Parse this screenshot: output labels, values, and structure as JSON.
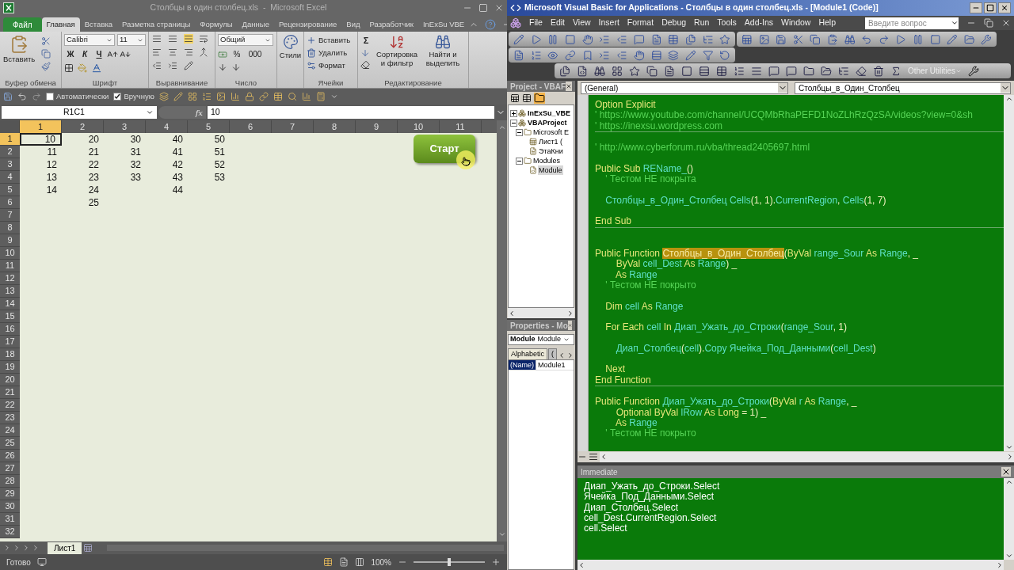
{
  "excel": {
    "title": "Столбцы в один столбец.xls  -  Microsoft Excel",
    "file_button": "Файл",
    "tabs": [
      {
        "label": "Главная",
        "selected": true
      },
      {
        "label": "Вставка",
        "selected": false
      },
      {
        "label": "Разметка страницы",
        "selected": false
      },
      {
        "label": "Формулы",
        "selected": false
      },
      {
        "label": "Данные",
        "selected": false
      },
      {
        "label": "Рецензирование",
        "selected": false
      },
      {
        "label": "Вид",
        "selected": false
      },
      {
        "label": "Разработчик",
        "selected": false
      },
      {
        "label": "InExSu VBE",
        "selected": false
      }
    ],
    "ribbon": {
      "clipboard": {
        "paste": "Вставить",
        "label": "Буфер обмена"
      },
      "font": {
        "name": "Calibri",
        "size": "11",
        "bold": "Ж",
        "italic": "К",
        "underline": "Ч",
        "label": "Шрифт"
      },
      "alignment": {
        "label": "Выравнивание"
      },
      "number": {
        "format": "Общий",
        "percent": "%",
        "thousands": "000",
        "label": "Число"
      },
      "styles": {
        "button": "Стили"
      },
      "cells": {
        "insert": "Вставить",
        "delete": "Удалить",
        "format": "Формат",
        "label": "Ячейки"
      },
      "editing": {
        "sum": "Σ",
        "sort": "Сортировка и фильтр",
        "find": "Найти и выделить",
        "label": "Редактирование"
      }
    },
    "calc_modes": [
      {
        "label": "Автоматически",
        "checked": false
      },
      {
        "label": "Вручную",
        "checked": true
      }
    ],
    "name_box": "R1C1",
    "function_label": "fx",
    "formula": "10",
    "columns": [
      {
        "label": "1",
        "selected": true
      },
      {
        "label": "2",
        "selected": false
      },
      {
        "label": "3",
        "selected": false
      },
      {
        "label": "4",
        "selected": false
      },
      {
        "label": "5",
        "selected": false
      },
      {
        "label": "6",
        "selected": false
      },
      {
        "label": "7",
        "selected": false
      },
      {
        "label": "8",
        "selected": false
      },
      {
        "label": "9",
        "selected": false
      },
      {
        "label": "10",
        "selected": false
      },
      {
        "label": "11",
        "selected": false
      }
    ],
    "rows": [
      {
        "label": "1",
        "selected": true,
        "cells": [
          "10",
          "20",
          "30",
          "40",
          "50"
        ]
      },
      {
        "label": "2",
        "selected": false,
        "cells": [
          "11",
          "21",
          "31",
          "41",
          "51"
        ]
      },
      {
        "label": "3",
        "selected": false,
        "cells": [
          "12",
          "22",
          "32",
          "42",
          "52"
        ]
      },
      {
        "label": "4",
        "selected": false,
        "cells": [
          "13",
          "23",
          "33",
          "43",
          "53"
        ]
      },
      {
        "label": "5",
        "selected": false,
        "cells": [
          "14",
          "24",
          null,
          "44"
        ]
      },
      {
        "label": "6",
        "selected": false,
        "cells": [
          null,
          "25"
        ]
      },
      {
        "label": "7",
        "selected": false
      },
      {
        "label": "8",
        "selected": false
      },
      {
        "label": "9",
        "selected": false
      },
      {
        "label": "10",
        "selected": false
      },
      {
        "label": "11",
        "selected": false
      },
      {
        "label": "12",
        "selected": false
      },
      {
        "label": "13",
        "selected": false
      },
      {
        "label": "14",
        "selected": false
      },
      {
        "label": "15",
        "selected": false
      },
      {
        "label": "16",
        "selected": false
      },
      {
        "label": "17",
        "selected": false
      },
      {
        "label": "18",
        "selected": false
      },
      {
        "label": "19",
        "selected": false
      },
      {
        "label": "20",
        "selected": false
      },
      {
        "label": "21",
        "selected": false
      },
      {
        "label": "22",
        "selected": false
      },
      {
        "label": "23",
        "selected": false
      },
      {
        "label": "24",
        "selected": false
      },
      {
        "label": "25",
        "selected": false
      },
      {
        "label": "26",
        "selected": false
      },
      {
        "label": "27",
        "selected": false
      },
      {
        "label": "28",
        "selected": false
      },
      {
        "label": "29",
        "selected": false
      },
      {
        "label": "30",
        "selected": false
      },
      {
        "label": "31",
        "selected": false
      },
      {
        "label": "32",
        "selected": false
      }
    ],
    "start_button": "Старт",
    "sheet_tabs": [
      {
        "label": "Лист1",
        "selected": true
      }
    ],
    "status_bar": {
      "status": "Готово",
      "zoom": {
        "label": "100%",
        "level": 0.5
      }
    }
  },
  "vba": {
    "title": "Microsoft Visual Basic for Applications - Столбцы в один столбец.xls - [Module1 (Code)]",
    "menus": [
      "File",
      "Edit",
      "View",
      "Insert",
      "Format",
      "Debug",
      "Run",
      "Tools",
      "Add-Ins",
      "Window",
      "Help"
    ],
    "search_placeholder": "Введите вопрос",
    "toolbar_button": "Other Utilities",
    "project": {
      "title": "Project - VBAF",
      "tree": [
        {
          "label": "InExSu_VBE",
          "kind": "project",
          "expanded": false,
          "selected": false
        },
        {
          "label": "VBAProject",
          "kind": "project",
          "expanded": true,
          "selected": false,
          "children": [
            {
              "label": "Microsoft E",
              "kind": "folder",
              "expanded": true,
              "selected": false,
              "children": [
                {
                  "label": "Лист1 (",
                  "kind": "sheet",
                  "selected": false
                },
                {
                  "label": "ЭтаКни",
                  "kind": "workbook",
                  "selected": false
                }
              ]
            },
            {
              "label": "Modules",
              "kind": "folder",
              "expanded": true,
              "selected": false,
              "children": [
                {
                  "label": "Module",
                  "kind": "module",
                  "selected": true
                }
              ]
            }
          ]
        }
      ]
    },
    "properties": {
      "title": "Properties - Mo",
      "object": "Module",
      "object_type": "Module",
      "tabs": [
        {
          "label": "Alphabetic",
          "selected": true
        },
        {
          "label": "(",
          "selected": false
        }
      ],
      "rows": [
        {
          "name": "(Name)",
          "value": "Module1",
          "selected": true
        }
      ]
    },
    "code": {
      "object": "(General)",
      "procedure": "Столбцы_в_Один_Столбец",
      "lines": [
        {
          "kind": "code",
          "tokens": [
            {
              "kind": "keyword",
              "text": "Option Explicit"
            }
          ]
        },
        {
          "kind": "code",
          "tokens": [
            {
              "kind": "comment",
              "text": "' https://www.youtube.com/channel/UCQMbRhaPEFD1NoZLhRzQzSA/videos?view=0&sh"
            }
          ]
        },
        {
          "kind": "code",
          "tokens": [
            {
              "kind": "comment",
              "text": "' https://inexsu.wordpress.com"
            }
          ]
        },
        {
          "kind": "divider"
        },
        {
          "kind": "blank"
        },
        {
          "kind": "code",
          "tokens": [
            {
              "kind": "comment",
              "text": "' http://www.cyberforum.ru/vba/thread2405697.html"
            }
          ]
        },
        {
          "kind": "blank"
        },
        {
          "kind": "code",
          "tokens": [
            {
              "kind": "keyword",
              "text": "Public Sub "
            },
            {
              "kind": "name",
              "text": "REName_"
            },
            {
              "kind": "text",
              "text": "()"
            }
          ]
        },
        {
          "kind": "code",
          "tokens": [
            {
              "kind": "comment",
              "text": "    ' Тестом НЕ покрыта"
            }
          ]
        },
        {
          "kind": "blank"
        },
        {
          "kind": "code",
          "tokens": [
            {
              "kind": "name",
              "text": "    Столбцы_в_Один_Столбец Cells"
            },
            {
              "kind": "text",
              "text": "(1, 1)."
            },
            {
              "kind": "name",
              "text": "CurrentRegion"
            },
            {
              "kind": "text",
              "text": ", "
            },
            {
              "kind": "name",
              "text": "Cells"
            },
            {
              "kind": "text",
              "text": "(1, 7)"
            }
          ]
        },
        {
          "kind": "blank"
        },
        {
          "kind": "code",
          "tokens": [
            {
              "kind": "keyword",
              "text": "End Sub"
            }
          ]
        },
        {
          "kind": "divider"
        },
        {
          "kind": "blank"
        },
        {
          "kind": "blank"
        },
        {
          "kind": "code",
          "tokens": [
            {
              "kind": "keyword",
              "text": "Public Function "
            },
            {
              "kind": "highlight",
              "text": "Столбцы_в_Один_Столбец"
            },
            {
              "kind": "text",
              "text": "("
            },
            {
              "kind": "keyword",
              "text": "ByVal "
            },
            {
              "kind": "name",
              "text": "range_Sour "
            },
            {
              "kind": "keyword",
              "text": "As "
            },
            {
              "kind": "name",
              "text": "Range"
            },
            {
              "kind": "text",
              "text": ", _"
            }
          ]
        },
        {
          "kind": "code",
          "tokens": [
            {
              "kind": "keyword",
              "text": "        ByVal "
            },
            {
              "kind": "name",
              "text": "cell_Dest "
            },
            {
              "kind": "keyword",
              "text": "As "
            },
            {
              "kind": "name",
              "text": "Range"
            },
            {
              "kind": "text",
              "text": ") _"
            }
          ]
        },
        {
          "kind": "code",
          "tokens": [
            {
              "kind": "keyword",
              "text": "        As "
            },
            {
              "kind": "name",
              "text": "Range"
            }
          ]
        },
        {
          "kind": "code",
          "tokens": [
            {
              "kind": "comment",
              "text": "    ' Тестом НЕ покрыто"
            }
          ]
        },
        {
          "kind": "blank"
        },
        {
          "kind": "code",
          "tokens": [
            {
              "kind": "keyword",
              "text": "    Dim "
            },
            {
              "kind": "name",
              "text": "cell "
            },
            {
              "kind": "keyword",
              "text": "As "
            },
            {
              "kind": "name",
              "text": "Range"
            }
          ]
        },
        {
          "kind": "blank"
        },
        {
          "kind": "code",
          "tokens": [
            {
              "kind": "keyword",
              "text": "    For Each "
            },
            {
              "kind": "name",
              "text": "cell "
            },
            {
              "kind": "keyword",
              "text": "In "
            },
            {
              "kind": "name",
              "text": "Диап_Ужать_до_Строки"
            },
            {
              "kind": "text",
              "text": "("
            },
            {
              "kind": "name",
              "text": "range_Sour"
            },
            {
              "kind": "text",
              "text": ", 1)"
            }
          ]
        },
        {
          "kind": "blank"
        },
        {
          "kind": "code",
          "tokens": [
            {
              "kind": "name",
              "text": "        Диап_Столбец"
            },
            {
              "kind": "text",
              "text": "("
            },
            {
              "kind": "name",
              "text": "cell"
            },
            {
              "kind": "text",
              "text": ")."
            },
            {
              "kind": "name",
              "text": "Copy Ячейка_Под_Данными"
            },
            {
              "kind": "text",
              "text": "("
            },
            {
              "kind": "name",
              "text": "cell_Dest"
            },
            {
              "kind": "text",
              "text": ")"
            }
          ]
        },
        {
          "kind": "blank"
        },
        {
          "kind": "code",
          "tokens": [
            {
              "kind": "keyword",
              "text": "    Next"
            }
          ]
        },
        {
          "kind": "code",
          "tokens": [
            {
              "kind": "keyword",
              "text": "End Function"
            }
          ]
        },
        {
          "kind": "divider"
        },
        {
          "kind": "blank"
        },
        {
          "kind": "code",
          "tokens": [
            {
              "kind": "keyword",
              "text": "Public Function "
            },
            {
              "kind": "name",
              "text": "Диап_Ужать_до_Строки"
            },
            {
              "kind": "text",
              "text": "("
            },
            {
              "kind": "keyword",
              "text": "ByVal "
            },
            {
              "kind": "name",
              "text": "r "
            },
            {
              "kind": "keyword",
              "text": "As "
            },
            {
              "kind": "name",
              "text": "Range"
            },
            {
              "kind": "text",
              "text": ", _"
            }
          ]
        },
        {
          "kind": "code",
          "tokens": [
            {
              "kind": "keyword",
              "text": "        Optional ByVal "
            },
            {
              "kind": "name",
              "text": "lRow "
            },
            {
              "kind": "keyword",
              "text": "As Long "
            },
            {
              "kind": "text",
              "text": "= 1) _"
            }
          ]
        },
        {
          "kind": "code",
          "tokens": [
            {
              "kind": "keyword",
              "text": "        As "
            },
            {
              "kind": "name",
              "text": "Range"
            }
          ]
        },
        {
          "kind": "code",
          "tokens": [
            {
              "kind": "comment",
              "text": "    ' Тестом НЕ покрыто"
            }
          ]
        }
      ]
    },
    "immediate": {
      "title": "Immediate",
      "lines": [
        "Диап_Ужать_до_Строки.Select",
        "Ячейка_Под_Данными.Select",
        "Диап_Столбец.Select",
        "cell_Dest.CurrentRegion.Select",
        "cell.Select"
      ]
    }
  }
}
